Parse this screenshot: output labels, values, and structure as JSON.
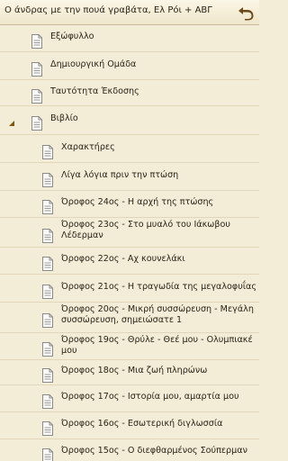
{
  "header": {
    "title": "Ο άνδρας με την πουά γραβάτα, Ελ Ρόι + ΑΒΓ",
    "back_icon": "back-arrow-icon"
  },
  "toc": {
    "items": [
      {
        "label": "Εξώφυλλο",
        "level": 1
      },
      {
        "label": "Δημιουργική Ομάδα",
        "level": 1
      },
      {
        "label": "Ταυτότητα Έκδοσης",
        "level": 1
      },
      {
        "label": "Βιβλίο",
        "level": 1,
        "expanded": true
      },
      {
        "label": "Χαρακτήρες",
        "level": 2
      },
      {
        "label": "Λίγα λόγια πριν την πτώση",
        "level": 2
      },
      {
        "label": "Όροφος 24ος - Η αρχή της πτώσης",
        "level": 2
      },
      {
        "label": "Όροφος 23ος - Στο μυαλό του Ιάκωβου Λέδερμαν",
        "level": 2
      },
      {
        "label": "Όροφος 22ος - Αχ κουνελάκι",
        "level": 2
      },
      {
        "label": "Όροφος 21ος - Η τραγωδία της μεγαλοφυΐας",
        "level": 2
      },
      {
        "label": "Όροφος 20ος - Μικρή συσσώρευση - Μεγάλη συσσώρευση, σημειώσατε 1",
        "level": 2
      },
      {
        "label": "Όροφος 19ος - Θρύλε - Θεέ μου - Ολυμπιακέ μου",
        "level": 2
      },
      {
        "label": "Όροφος 18ος - Μια ζωή πληρώνω",
        "level": 2
      },
      {
        "label": "Όροφος 17ος - Ιστορία μου, αμαρτία μου",
        "level": 2
      },
      {
        "label": "Όροφος 16ος - Εσωτερική διγλωσσία",
        "level": 2
      },
      {
        "label": "Όροφος 15ος - Ο διεφθαρμένος Σούπερμαν",
        "level": 2
      }
    ]
  },
  "colors": {
    "background": "#f3ecd6",
    "text": "#2a2418",
    "icon": "#8a8a8a",
    "back_arrow": "#6b4a1a",
    "expander": "#7a5a14"
  }
}
